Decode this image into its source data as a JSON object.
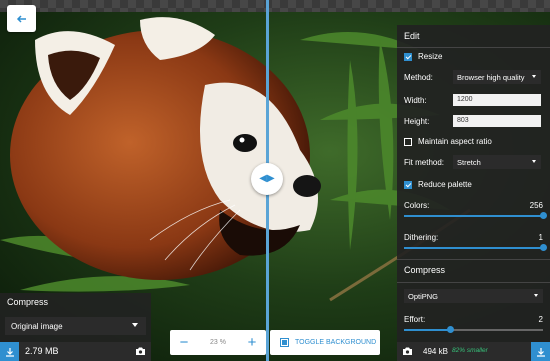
{
  "left_panel": {
    "title": "Compress",
    "method": "Original image",
    "file_size": "2.79 MB"
  },
  "zoom": {
    "minus": "−",
    "value": "23",
    "unit": "%",
    "plus": "+"
  },
  "toggle_background": "TOGGLE BACKGROUND",
  "edit": {
    "title": "Edit",
    "resize_label": "Resize",
    "resize_checked": true,
    "method_label": "Method:",
    "method_value": "Browser high quality",
    "width_label": "Width:",
    "width_value": "1200",
    "height_label": "Height:",
    "height_value": "803",
    "aspect_label": "Maintain aspect ratio",
    "aspect_checked": false,
    "fit_label": "Fit method:",
    "fit_value": "Stretch",
    "palette_label": "Reduce palette",
    "palette_checked": true,
    "colors_label": "Colors:",
    "colors_value": "256",
    "colors_fraction": 1.0,
    "dithering_label": "Dithering:",
    "dithering_value": "1",
    "dithering_fraction": 1.0
  },
  "compress": {
    "title": "Compress",
    "codec": "OptiPNG",
    "effort_label": "Effort:",
    "effort_value": "2",
    "effort_fraction": 0.33,
    "file_size": "494 kB",
    "savings": "82% smaller"
  },
  "colors": {
    "accent": "#2f8fd0",
    "savings": "#37c07a"
  }
}
